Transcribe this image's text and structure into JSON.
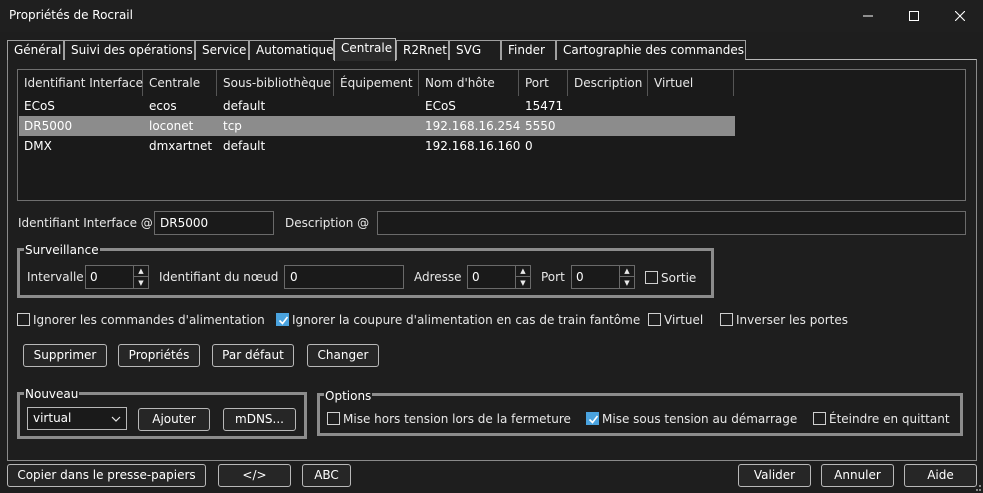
{
  "window": {
    "title": "Propriétés de Rocrail"
  },
  "tabs": [
    {
      "label": "Général"
    },
    {
      "label": "Suivi des opérations"
    },
    {
      "label": "Service"
    },
    {
      "label": "Automatique"
    },
    {
      "label": "Centrale",
      "active": true
    },
    {
      "label": "R2Rnet"
    },
    {
      "label": "SVG"
    },
    {
      "label": "Finder"
    },
    {
      "label": "Cartographie des commandes"
    }
  ],
  "table": {
    "columns": [
      "Identifiant Interface",
      "Centrale",
      "Sous-bibliothèque",
      "Équipement",
      "Nom d'hôte",
      "Port",
      "Description",
      "Virtuel"
    ],
    "rows": [
      {
        "id": "ECoS",
        "central": "ecos",
        "sublib": "default",
        "device": "",
        "host": "ECoS",
        "port": "15471",
        "desc": "",
        "virtual": "",
        "selected": false
      },
      {
        "id": "DR5000",
        "central": "loconet",
        "sublib": "tcp",
        "device": "",
        "host": "192.168.16.254",
        "port": "5550",
        "desc": "",
        "virtual": "",
        "selected": true
      },
      {
        "id": "DMX",
        "central": "dmxartnet",
        "sublib": "default",
        "device": "",
        "host": "192.168.16.160",
        "port": "0",
        "desc": "",
        "virtual": "",
        "selected": false
      }
    ]
  },
  "form": {
    "id_label": "Identifiant Interface @",
    "id_value": "DR5000",
    "desc_label": "Description @",
    "desc_value": ""
  },
  "surveillance": {
    "title": "Surveillance",
    "interval_label": "Intervalle",
    "interval_value": "0",
    "node_label": "Identifiant du nœud",
    "node_value": "0",
    "address_label": "Adresse",
    "address_value": "0",
    "port_label": "Port",
    "port_value": "0",
    "output_label": "Sortie",
    "output_checked": false
  },
  "options_row": {
    "ignore_power_label": "Ignorer les commandes d'alimentation",
    "ignore_power_checked": false,
    "ignore_ghost_label": "Ignorer la coupure d'alimentation en cas de train fantôme",
    "ignore_ghost_checked": true,
    "virtual_label": "Virtuel",
    "virtual_checked": false,
    "invert_label": "Inverser les portes",
    "invert_checked": false
  },
  "actions": {
    "delete": "Supprimer",
    "properties": "Propriétés",
    "default": "Par défaut",
    "change": "Changer"
  },
  "nouveau": {
    "title": "Nouveau",
    "type_value": "virtual",
    "add": "Ajouter",
    "mdns": "mDNS..."
  },
  "options": {
    "title": "Options",
    "power_off_close_label": "Mise hors tension lors de la fermeture",
    "power_off_close_checked": false,
    "power_on_start_label": "Mise sous tension au démarrage",
    "power_on_start_checked": true,
    "power_off_quit_label": "Éteindre en quittant",
    "power_off_quit_checked": false
  },
  "footer": {
    "copy": "Copier dans le presse-papiers",
    "code": "</>",
    "abc": "ABC",
    "ok": "Valider",
    "cancel": "Annuler",
    "help": "Aide"
  },
  "colors": {
    "background": "#1e1e1e",
    "selected_row": "#8c8c8c",
    "checkbox_checked": "#4aa3df"
  }
}
